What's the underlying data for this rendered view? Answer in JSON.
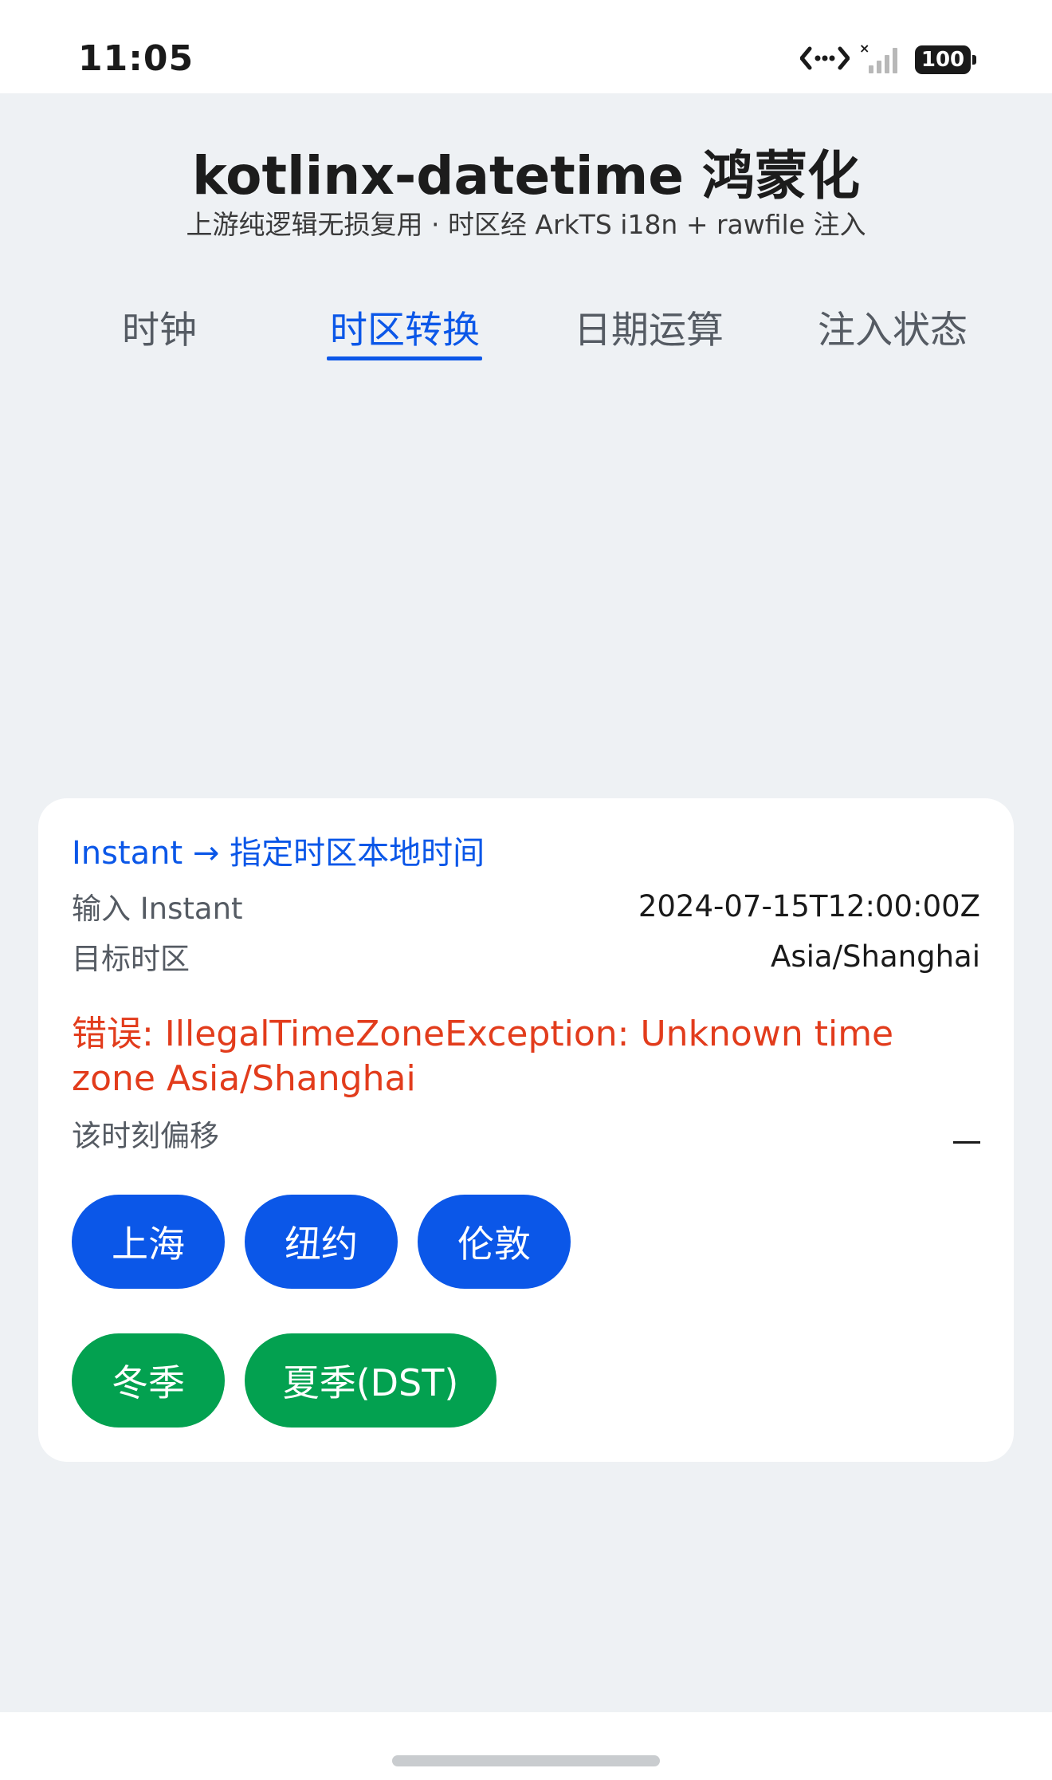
{
  "status_bar": {
    "time": "11:05",
    "battery": "100",
    "icons": [
      "data-transfer-icon",
      "no-signal-icon",
      "battery-icon"
    ]
  },
  "header": {
    "title": "kotlinx-datetime 鸿蒙化",
    "subtitle": "上游纯逻辑无损复用 · 时区经 ArkTS i18n + rawfile 注入"
  },
  "tabs": [
    {
      "label": "时钟",
      "active": false
    },
    {
      "label": "时区转换",
      "active": true
    },
    {
      "label": "日期运算",
      "active": false
    },
    {
      "label": "注入状态",
      "active": false
    }
  ],
  "card": {
    "title": "Instant → 指定时区本地时间",
    "input_label": "输入 Instant",
    "input_value": "2024-07-15T12:00:00Z",
    "zone_label": "目标时区",
    "zone_value": "Asia/Shanghai",
    "error": "错误: IllegalTimeZoneException: Unknown time zone Asia/Shanghai",
    "offset_label": "该时刻偏移",
    "offset_value": "—",
    "zone_buttons": [
      "上海",
      "纽约",
      "伦敦"
    ],
    "season_buttons": [
      "冬季",
      "夏季(DST)"
    ]
  },
  "colors": {
    "accent": "#0b57e8",
    "green": "#03a150",
    "error": "#e23c1c",
    "background": "#eef1f4"
  }
}
